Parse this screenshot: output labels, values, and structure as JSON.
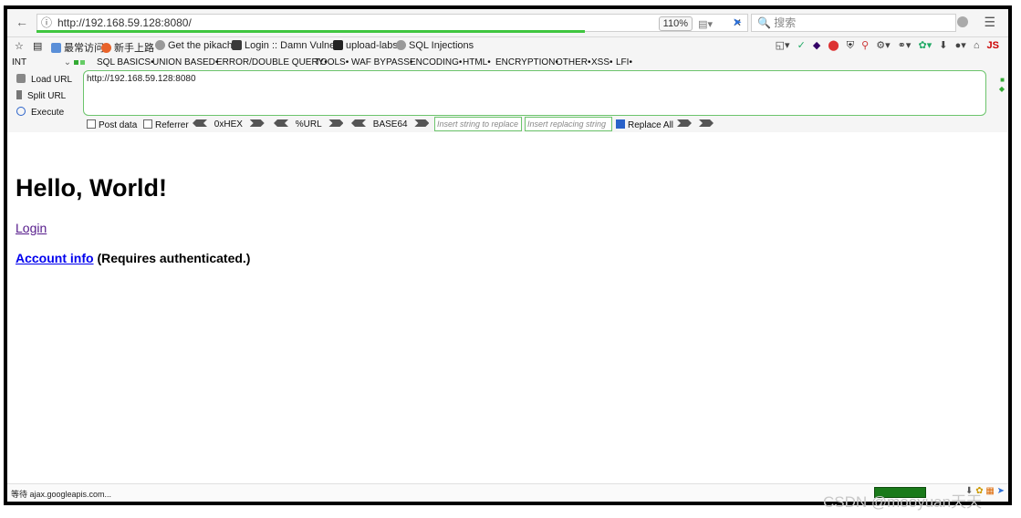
{
  "browser": {
    "url": "http://192.168.59.128:8080/",
    "zoom": "110%",
    "search_placeholder": "搜索",
    "load_progress": 0.77
  },
  "bookmarks": [
    "最常访问",
    "新手上路",
    "Get the pikachu",
    "Login :: Damn Vulne...",
    "upload-labs",
    "SQL Injections"
  ],
  "hackbar": {
    "menu_first": "INT",
    "menu_items": [
      "SQL BASICS",
      "UNION BASED",
      "ERROR/DOUBLE QUERY",
      "TOOLS",
      "WAF BYPASS",
      "ENCODING",
      "HTML",
      "ENCRYPTION",
      "OTHER",
      "XSS",
      "LFI"
    ],
    "load_url": "Load URL",
    "split_url": "Split URL",
    "execute": "Execute",
    "url_text": "http://192.168.59.128:8080",
    "post_data": "Post data",
    "referrer": "Referrer",
    "hex": "0xHEX",
    "urlenc": "%URL",
    "base64": "BASE64",
    "insert_placeholder": "Insert string to replace",
    "replacing_placeholder": "Insert replacing string",
    "replace_all": "Replace All"
  },
  "page": {
    "heading": "Hello, World!",
    "login_link": "Login",
    "account_link": "Account info",
    "account_note": "(Requires authenticated.)"
  },
  "status": {
    "text": "等待 ajax.googleapis.com..."
  },
  "watermark": "CSDN @mooyuan天天",
  "colors": {
    "hackbar_border": "#6cc46c",
    "progress_green": "#3fc63f",
    "link_blue": "#0000ee",
    "visited_purple": "#551a8b"
  }
}
